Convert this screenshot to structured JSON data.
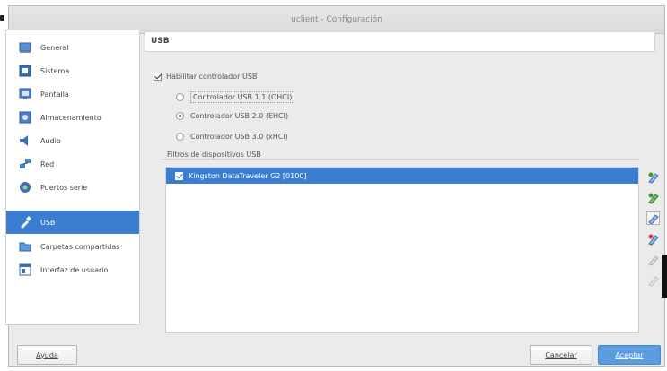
{
  "window": {
    "title": "uclient - Configuración"
  },
  "sidebar": {
    "items": [
      {
        "label": "General",
        "icon": "general-icon"
      },
      {
        "label": "Sistema",
        "icon": "system-icon"
      },
      {
        "label": "Pantalla",
        "icon": "display-icon"
      },
      {
        "label": "Almacenamiento",
        "icon": "storage-icon"
      },
      {
        "label": "Audio",
        "icon": "audio-icon"
      },
      {
        "label": "Red",
        "icon": "network-icon"
      },
      {
        "label": "Puertos serie",
        "icon": "serial-ports-icon"
      },
      {
        "label": "USB",
        "icon": "usb-icon",
        "selected": true
      },
      {
        "label": "Carpetas compartidas",
        "icon": "shared-folders-icon"
      },
      {
        "label": "Interfaz de usuario",
        "icon": "user-interface-icon"
      }
    ]
  },
  "section": {
    "title": "USB"
  },
  "usb": {
    "enable_label": "Habilitar controlador USB",
    "enable_checked": true,
    "controllers": [
      {
        "label": "Controlador USB 1.1 (OHCI)",
        "selected": false
      },
      {
        "label": "Controlador USB 2.0 (EHCI)",
        "selected": true
      },
      {
        "label": "Controlador USB 3.0 (xHCI)",
        "selected": false
      }
    ],
    "filters_label": "Filtros de dispositivos USB",
    "filters": [
      {
        "label": "Kingston DataTraveler G2 [0100]",
        "checked": true
      }
    ],
    "toolbar": [
      "add-filter-icon",
      "add-from-device-icon",
      "edit-filter-icon",
      "remove-filter-icon",
      "move-up-icon",
      "move-down-icon"
    ]
  },
  "buttons": {
    "help": "Ayuda",
    "cancel": "Cancelar",
    "accept": "Aceptar"
  },
  "colors": {
    "selection": "#3b7ed1",
    "accept_button": "#5b9be0",
    "window_bg": "#ebebeb"
  }
}
